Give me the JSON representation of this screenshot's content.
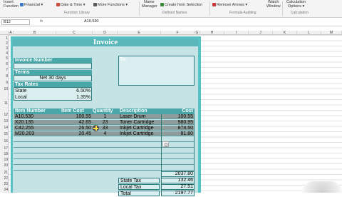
{
  "ribbon": {
    "items": [
      {
        "label": "Insert"
      },
      {
        "label": "Function"
      },
      {
        "label": "Financial"
      },
      {
        "label": "Date & Time"
      },
      {
        "label": "More Functions"
      },
      {
        "label": "Name"
      },
      {
        "label": "Manager"
      },
      {
        "label": "Create from Selection"
      },
      {
        "label": "Remove Arrows"
      },
      {
        "label": "Watch"
      },
      {
        "label": "Window"
      },
      {
        "label": "Calculation"
      },
      {
        "label": "Options"
      }
    ],
    "groups": [
      "Function Library",
      "Defined Names",
      "Formula Auditing",
      "Calculation"
    ]
  },
  "formula_bar": {
    "name_box": "B12",
    "fx": "fx",
    "content": "A10.530"
  },
  "columns": [
    "A",
    "B",
    "C",
    "D",
    "E",
    "F",
    "G",
    "H",
    "I",
    "J",
    "K",
    "L",
    "M"
  ],
  "rows": [
    "1",
    "2",
    "3",
    "4",
    "5",
    "6",
    "7",
    "8",
    "9",
    "10",
    "11",
    "12",
    "13",
    "14",
    "15",
    "16",
    "17",
    "18",
    "19",
    "20",
    "21",
    "22",
    "23",
    "24"
  ],
  "invoice": {
    "title": "Invoice",
    "invoice_number_label": "Invoice Number",
    "to_label": "To:",
    "terms_label": "Terms",
    "terms_value": "Net 30 days",
    "tax_rates_label": "Tax Rates",
    "state_label": "State",
    "state_rate": "6.50%",
    "local_label": "Local",
    "local_rate": "1.35%",
    "headers": [
      "Item Number",
      "Item Cost",
      "Quantity",
      "Description",
      "Cost"
    ],
    "lines": [
      {
        "item": "A10.530",
        "cost": "100.55",
        "qty": "1",
        "desc": "Laser Drum",
        "total": "100.55"
      },
      {
        "item": "X20.135",
        "cost": "42.65",
        "qty": "23",
        "desc": "Toner Cartridge",
        "total": "980.95"
      },
      {
        "item": "C42.255",
        "cost": "26.50",
        "qty": "33",
        "desc": "Inkjet Cartridge",
        "total": "874.50"
      },
      {
        "item": "M20.203",
        "cost": "20.45",
        "qty": "4",
        "desc": "Inkjet Cartridge",
        "total": "81.80"
      }
    ],
    "subtotal": "2037.80",
    "state_tax_label": "State Tax",
    "state_tax": "132.46",
    "local_tax_label": "Local Tax",
    "local_tax": "27.51",
    "total_label": "Total",
    "total": "2197.77"
  }
}
